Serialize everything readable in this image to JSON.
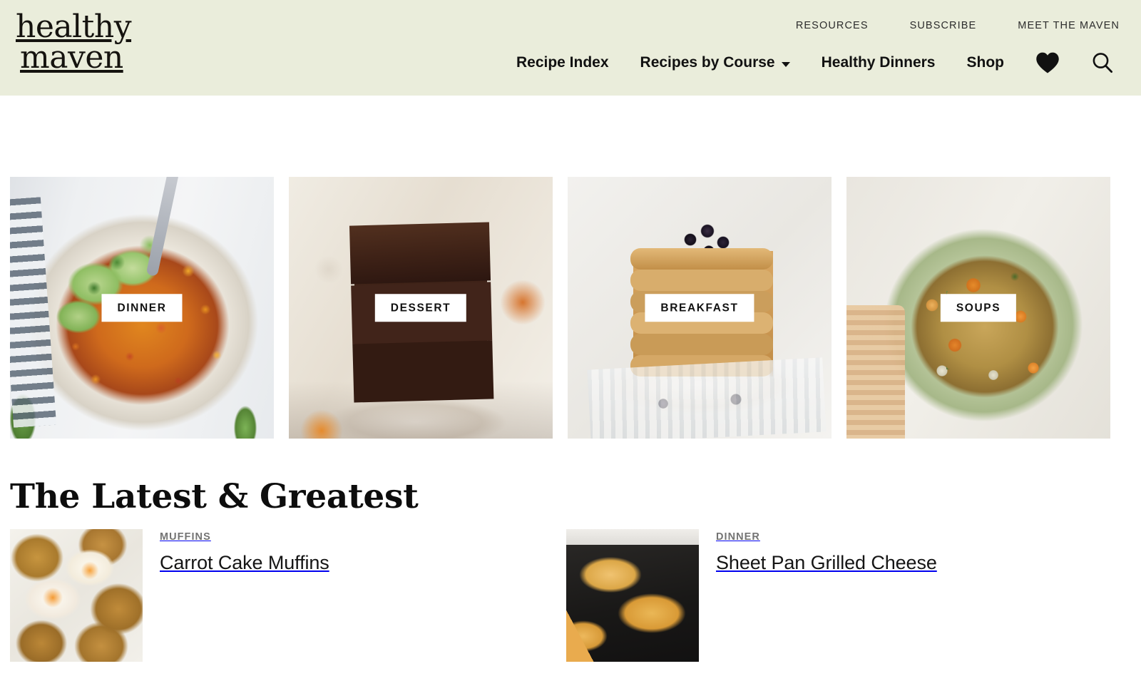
{
  "site": {
    "logo_line1": "healthy",
    "logo_line2": "maven",
    "header_bg": "#eaeddb",
    "accent_text": "#111111"
  },
  "topnav": {
    "items": [
      {
        "label": "RESOURCES"
      },
      {
        "label": "SUBSCRIBE"
      },
      {
        "label": "MEET THE MAVEN"
      }
    ]
  },
  "mainnav": {
    "items": [
      {
        "label": "Recipe Index",
        "has_dropdown": false
      },
      {
        "label": "Recipes by Course",
        "has_dropdown": true
      },
      {
        "label": "Healthy Dinners",
        "has_dropdown": false
      },
      {
        "label": "Shop",
        "has_dropdown": false
      }
    ],
    "icons": [
      {
        "name": "heart-icon"
      },
      {
        "name": "search-icon"
      }
    ]
  },
  "categories": [
    {
      "label": "DINNER"
    },
    {
      "label": "DESSERT"
    },
    {
      "label": "BREAKFAST"
    },
    {
      "label": "SOUPS"
    }
  ],
  "latest": {
    "heading": "The Latest & Greatest",
    "posts": [
      {
        "category": "MUFFINS",
        "title": "Carrot Cake Muffins"
      },
      {
        "category": "DINNER",
        "title": "Sheet Pan Grilled Cheese"
      }
    ]
  }
}
